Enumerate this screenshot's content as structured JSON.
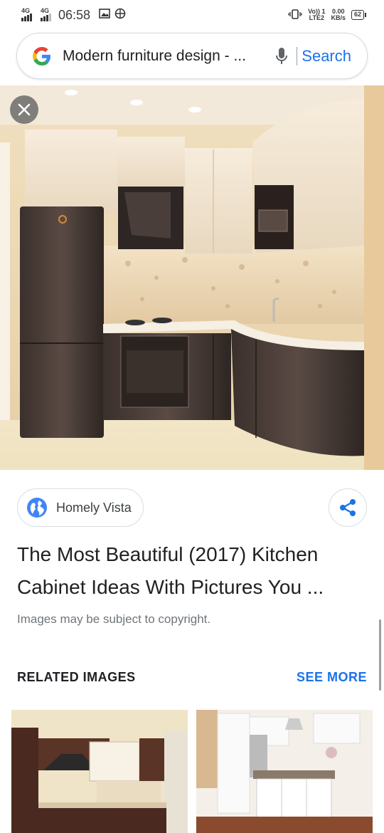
{
  "status_bar": {
    "sim1": "4G",
    "sim2": "4G",
    "time": "06:58",
    "volte": "Vo)) 1",
    "lte": "LTE2",
    "speed_value": "0.00",
    "speed_unit": "KB/s",
    "battery": "62"
  },
  "search": {
    "query": "Modern furniture design - ...",
    "action_label": "Search"
  },
  "source": {
    "name": "Homely Vista"
  },
  "result": {
    "title": "The Most Beautiful (2017) Kitchen Cabinet Ideas With Pictures You ...",
    "copyright_note": "Images may be subject to copyright."
  },
  "related": {
    "heading": "RELATED IMAGES",
    "see_more": "SEE MORE"
  },
  "colors": {
    "link_blue": "#1a73e8",
    "google_blue": "#4285F4",
    "google_red": "#EA4335",
    "google_yellow": "#FBBC05",
    "google_green": "#34A853"
  },
  "icons": {
    "close": "close-icon",
    "share": "share-icon",
    "globe": "globe-icon",
    "mic": "mic-icon",
    "google": "google-logo"
  }
}
